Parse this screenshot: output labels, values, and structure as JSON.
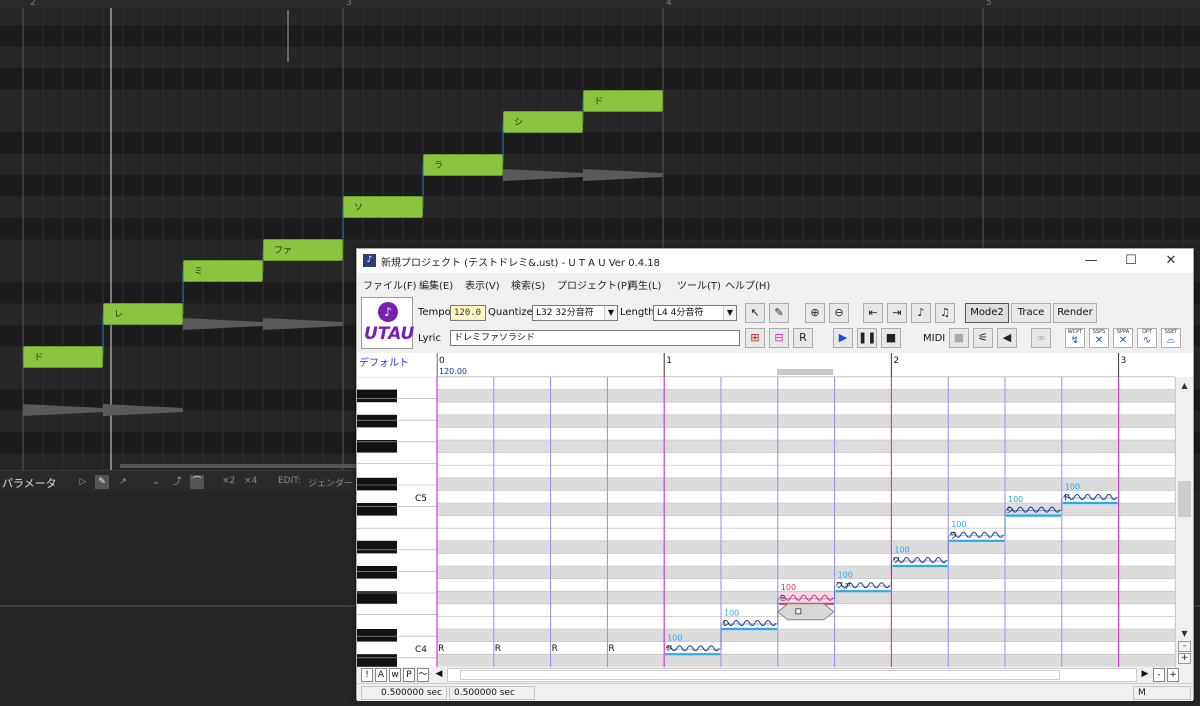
{
  "background_app": {
    "measure_numbers": [
      "2",
      "3",
      "4",
      "5"
    ],
    "notes": [
      {
        "lyric": "ド"
      },
      {
        "lyric": "レ"
      },
      {
        "lyric": "ミ"
      },
      {
        "lyric": "ファ"
      },
      {
        "lyric": "ソ"
      },
      {
        "lyric": "ラ"
      },
      {
        "lyric": "シ"
      },
      {
        "lyric": "ド"
      }
    ],
    "param_panel": {
      "title": "パラメータ",
      "zoom_x2": "×2",
      "zoom_x4": "×4",
      "edit_label": "EDIT:",
      "edit_value": "ジェンダー"
    },
    "colors": {
      "note": "#8bc43f",
      "bg": "#232323",
      "ghost": "#5a5a5a"
    }
  },
  "window": {
    "title": "新規プロジェクト (テストドレミ&.ust) - U T A U Ver 0.4.18",
    "controls": {
      "minimize": "—",
      "maximize": "☐",
      "close": "✕"
    },
    "menu": [
      "ファイル(F)",
      "編集(E)",
      "表示(V)",
      "検索(S)",
      "プロジェクト(P)",
      "再生(L)",
      "ツール(T)",
      "ヘルプ(H)"
    ],
    "logo": {
      "text": "UTAU",
      "symbol": "♪"
    },
    "toolbar": {
      "tempo_label": "Tempo",
      "tempo_value": "120.0",
      "quantize_label": "Quantize",
      "quantize_value": "L32 32分音符",
      "length_label": "Length",
      "length_value": "L4  4分音符",
      "lyric_label": "Lyric",
      "lyric_value": "ドレミファソラシド",
      "midi_label": "MIDI",
      "mode2_label": "Mode2",
      "trace_label": "Trace",
      "render_label": "Render",
      "plugins": [
        {
          "top": "WCPT",
          "glyph": "↯"
        },
        {
          "top": "SSPS",
          "glyph": "✕"
        },
        {
          "top": "SPPA",
          "glyph": "✕"
        },
        {
          "top": "OPT",
          "glyph": "∿"
        },
        {
          "top": "SSET",
          "glyph": "⌓"
        }
      ]
    },
    "editor": {
      "track_name": "デフォルト",
      "ruler_labels": [
        "0",
        "1",
        "2",
        "3"
      ],
      "tempo_marker": "120.00",
      "piano_labels": [
        "C5",
        "C4"
      ],
      "rests": [
        "R",
        "R",
        "R",
        "R"
      ],
      "notes": [
        {
          "lyric": "ド",
          "intensity": "100"
        },
        {
          "lyric": "レ",
          "intensity": "100"
        },
        {
          "lyric": "ミ",
          "intensity": "100",
          "selected": true
        },
        {
          "lyric": "ファ",
          "intensity": "100"
        },
        {
          "lyric": "ソ",
          "intensity": "100"
        },
        {
          "lyric": "ラ",
          "intensity": "100"
        },
        {
          "lyric": "シ",
          "intensity": "100"
        },
        {
          "lyric": "ド",
          "intensity": "100"
        }
      ],
      "colors": {
        "note_line": "#2aa8e8",
        "selected": "#e0306e",
        "bar_line": "#d63bd6",
        "beat_line": "#8f8ff5",
        "black_row": "#dcdcdc"
      }
    },
    "bottom_buttons": [
      "!",
      "A",
      "w",
      "P",
      "〜"
    ],
    "zoom_buttons": [
      "-",
      "+"
    ],
    "status": {
      "left": "0.500000 sec",
      "middle": "0.500000 sec",
      "right": "M"
    }
  }
}
